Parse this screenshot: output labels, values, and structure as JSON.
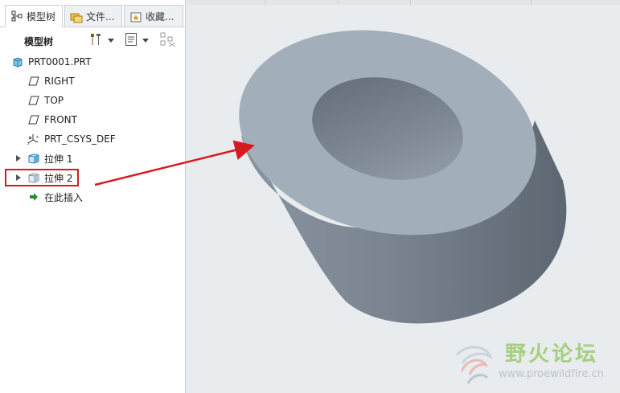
{
  "tabs": [
    {
      "label": "模型树",
      "icon": "model-tree-icon",
      "active": true
    },
    {
      "label": "文件...",
      "icon": "folder-browser-icon",
      "active": false
    },
    {
      "label": "收藏...",
      "icon": "favorites-icon",
      "active": false
    }
  ],
  "toolbar": {
    "title": "模型树",
    "buttons": [
      "settings-tools-icon",
      "show-options-icon",
      "filter-icon"
    ]
  },
  "tree": {
    "root": {
      "label": "PRT0001.PRT",
      "icon": "part-icon"
    },
    "items": [
      {
        "label": "RIGHT",
        "icon": "datum-plane-icon"
      },
      {
        "label": "TOP",
        "icon": "datum-plane-icon"
      },
      {
        "label": "FRONT",
        "icon": "datum-plane-icon"
      },
      {
        "label": "PRT_CSYS_DEF",
        "icon": "coordinate-system-icon"
      },
      {
        "label": "拉伸 1",
        "icon": "extrude-icon",
        "expandable": true
      },
      {
        "label": "拉伸 2",
        "icon": "extrude-icon",
        "expandable": true,
        "highlighted": true
      },
      {
        "label": "在此插入",
        "icon": "insert-here-arrow-icon"
      }
    ]
  },
  "watermark": {
    "title": "野火论坛",
    "url": "www.proewildfire.cn"
  },
  "colors": {
    "highlight": "#d71920",
    "arrow": "#d71920",
    "model_top": "#a3aebb",
    "model_side": "#6f7a86"
  }
}
